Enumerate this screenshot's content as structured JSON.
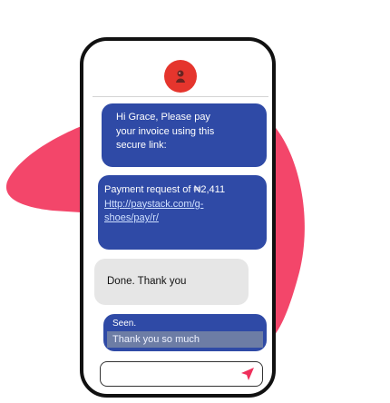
{
  "chat": {
    "avatar_icon": "mascot-icon",
    "messages": [
      {
        "lines": [
          "Hi Grace, Please pay",
          "your invoice using this",
          "secure link:"
        ]
      },
      {
        "text": "Payment request of ₦2,411",
        "link_lines": [
          "Http://paystack.com/g-",
          "shoes/pay/r/"
        ]
      },
      {
        "text": "Done. Thank you"
      },
      {
        "status": "Seen.",
        "text": "Thank you so much"
      }
    ],
    "input": {
      "value": "",
      "send_icon": "send-icon"
    }
  },
  "colors": {
    "blob": "#f3466a",
    "avatar": "#e5352d",
    "outgoing_bubble": "#2f4aa6",
    "incoming_bubble": "#e6e6e6",
    "send_icon": "#ef2f5b"
  }
}
